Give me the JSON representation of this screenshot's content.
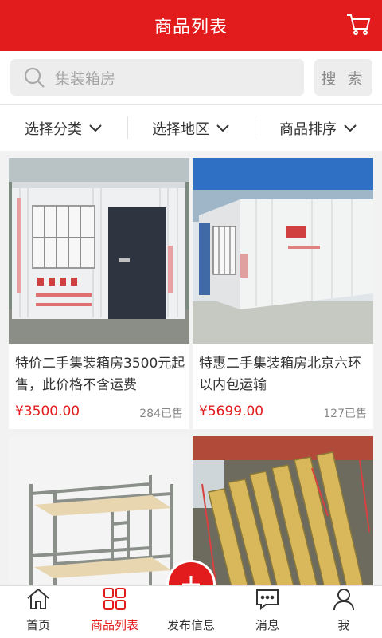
{
  "header": {
    "title": "商品列表",
    "cart_icon": "cart-icon"
  },
  "search": {
    "placeholder": "集装箱房",
    "button_label": "搜 索"
  },
  "filters": [
    {
      "label": "选择分类"
    },
    {
      "label": "选择地区"
    },
    {
      "label": "商品排序"
    }
  ],
  "products": [
    {
      "name": "特价二手集装箱房3500元起售，此价格不含运费",
      "price": "¥3500.00",
      "sold": "284已售",
      "image": "container-office-photo"
    },
    {
      "name": "特惠二手集装箱房北京六环以内包运输",
      "price": "¥5699.00",
      "sold": "127已售",
      "image": "container-house-photo"
    },
    {
      "name": "",
      "price": "",
      "sold": "",
      "image": "bunk-bed-photo"
    },
    {
      "name": "",
      "price": "",
      "sold": "",
      "image": "sandwich-panels-photo"
    }
  ],
  "tabbar": {
    "items": [
      {
        "label": "首页",
        "icon": "home-icon"
      },
      {
        "label": "商品列表",
        "icon": "grid-icon",
        "active": true
      },
      {
        "label": "发布信息",
        "icon": "plus-icon"
      },
      {
        "label": "消息",
        "icon": "message-icon"
      },
      {
        "label": "我",
        "icon": "user-icon"
      }
    ]
  },
  "colors": {
    "brand": "#e21c1c",
    "background": "#f2f2f2"
  }
}
